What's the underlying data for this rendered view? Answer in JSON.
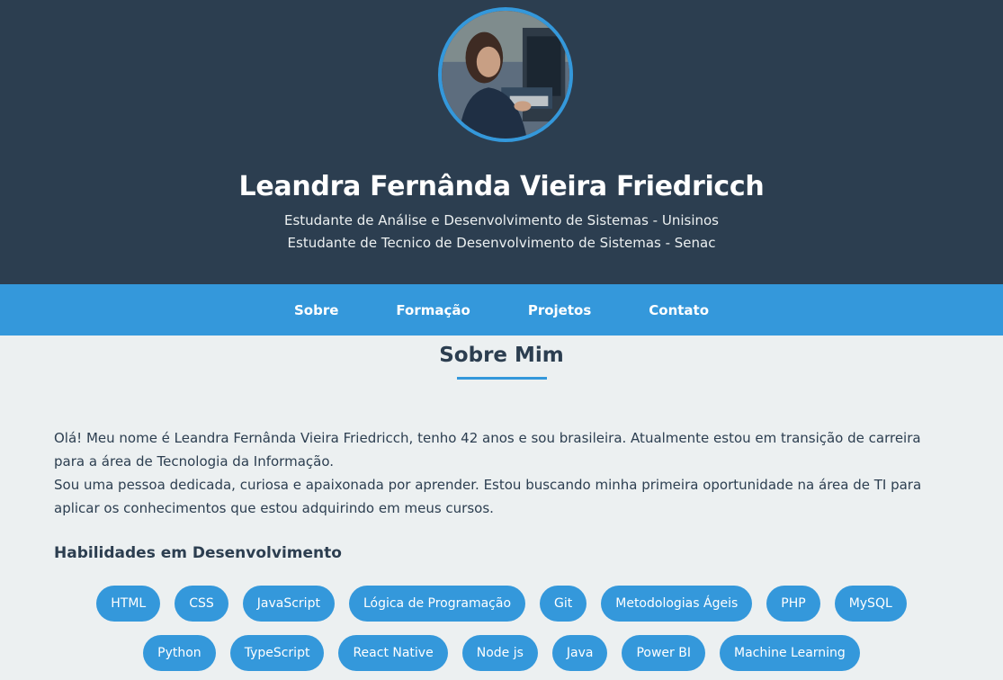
{
  "hero": {
    "name": "Leandra Fernânda Vieira Friedricch",
    "subtitle_1": "Estudante de Análise e Desenvolvimento de Sistemas - Unisinos",
    "subtitle_2": "Estudante de Tecnico de Desenvolvimento de Sistemas - Senac",
    "photo_icon": "profile-photo"
  },
  "nav": {
    "items": [
      "Sobre",
      "Formação",
      "Projetos",
      "Contato"
    ]
  },
  "about": {
    "title": "Sobre Mim",
    "paragraph_1": "Olá! Meu nome é Leandra Fernânda Vieira Friedricch, tenho 42 anos e sou brasileira. Atualmente estou em transição de carreira para a área de Tecnologia da Informação.",
    "paragraph_2": "Sou uma pessoa dedicada, curiosa e apaixonada por aprender. Estou buscando minha primeira oportunidade na área de TI para aplicar os conhecimentos que estou adquirindo em meus cursos."
  },
  "skills": {
    "title": "Habilidades em Desenvolvimento",
    "items": [
      "HTML",
      "CSS",
      "JavaScript",
      "Lógica de Programação",
      "Git",
      "Metodologias Ágeis",
      "PHP",
      "MySQL",
      "Python",
      "TypeScript",
      "React Native",
      "Node js",
      "Java",
      "Power BI",
      "Machine Learning"
    ]
  },
  "colors": {
    "header_bg": "#2c3e50",
    "accent": "#3498db",
    "page_bg": "#ecf0f1"
  }
}
